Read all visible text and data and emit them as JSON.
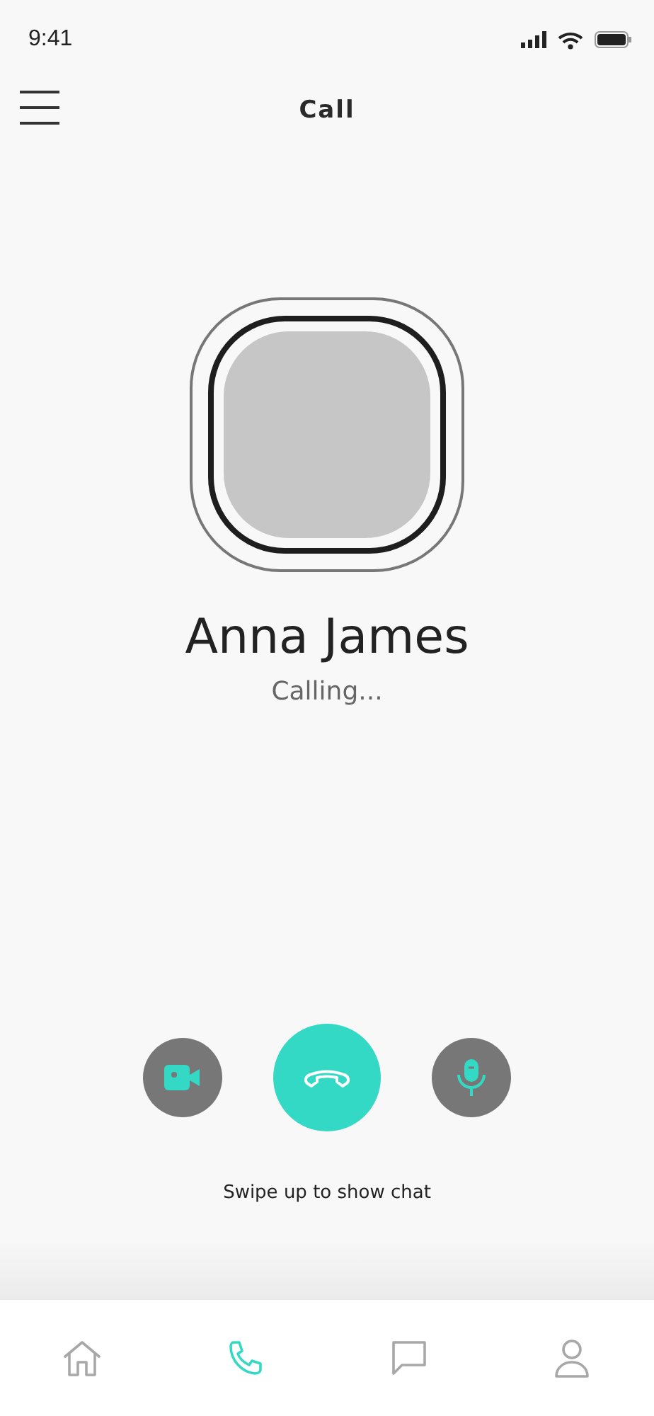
{
  "status_bar": {
    "time": "9:41"
  },
  "header": {
    "title": "Call"
  },
  "contact": {
    "name": "Anna James",
    "status": "Calling..."
  },
  "controls": [
    {
      "kind": "video"
    },
    {
      "kind": "end"
    },
    {
      "kind": "mic"
    }
  ],
  "hint": "Swipe up to show chat",
  "nav": [
    {
      "kind": "home",
      "selected": false
    },
    {
      "kind": "phone",
      "selected": true
    },
    {
      "kind": "chat",
      "selected": false
    },
    {
      "kind": "profile",
      "selected": false
    }
  ]
}
